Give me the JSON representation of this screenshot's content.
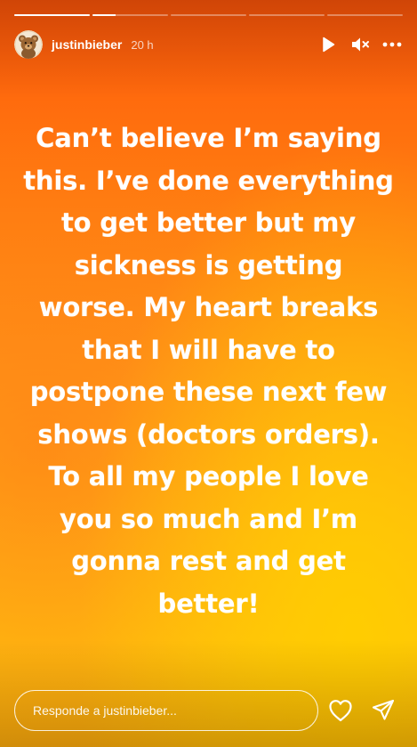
{
  "progress": {
    "segments": [
      {
        "fill": 1.0
      },
      {
        "fill": 0.3
      },
      {
        "fill": 0.0
      },
      {
        "fill": 0.0
      },
      {
        "fill": 0.0
      }
    ]
  },
  "header": {
    "username": "justinbieber",
    "timestamp": "20 h",
    "avatar_icon": "teddy-bear-avatar",
    "controls": [
      "play-icon",
      "mute-icon",
      "more-icon"
    ]
  },
  "story": {
    "lines": [
      "Can’t believe I’m saying",
      "this. I’ve done everything",
      "to get better but my",
      "sickness is getting",
      "worse. My heart breaks",
      "that I will have to",
      "postpone these next few",
      "shows (doctors orders).",
      "To all my people I love",
      "you so much and I’m",
      "gonna rest and get",
      "better!"
    ],
    "background_colors": [
      "#ff5a0a",
      "#ff9a18",
      "#ffc10e"
    ]
  },
  "footer": {
    "reply_placeholder": "Responde a justinbieber...",
    "icons": [
      "heart-icon",
      "send-icon"
    ]
  }
}
